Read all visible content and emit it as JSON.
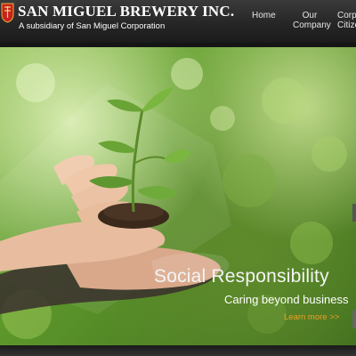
{
  "header": {
    "brand_name": "SAN MIGUEL BREWERY INC.",
    "tagline": "A subsidiary of San Miguel Corporation",
    "nav": [
      {
        "line1": "Home",
        "line2": ""
      },
      {
        "line1": "Our",
        "line2": "Company"
      },
      {
        "line1": "Corp",
        "line2": "Citize"
      }
    ]
  },
  "hero": {
    "title": "Social Responsibility",
    "subtitle": "Caring beyond business",
    "link_label": "Learn more >>"
  },
  "colors": {
    "header_bg": "#262626",
    "accent_link": "#f0a020",
    "logo_red": "#c8211d"
  },
  "icons": {
    "logo": "san-miguel-shield-icon"
  }
}
